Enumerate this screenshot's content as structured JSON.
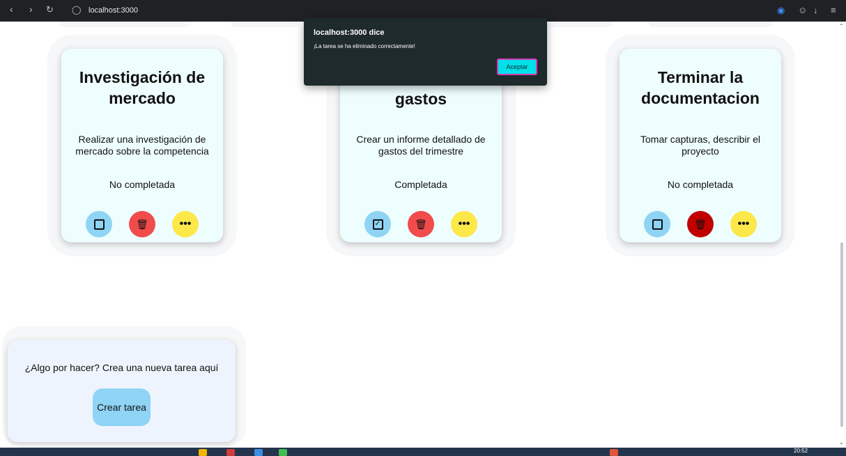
{
  "browser": {
    "url": "localhost:3000",
    "back_icon": "chevron-left-icon",
    "forward_icon": "chevron-right-icon",
    "reload_icon": "reload-icon",
    "site_icon": "globe-icon"
  },
  "cards": [
    {
      "title": "Investigación de mercado",
      "description": "Realizar una investigación de mercado sobre la competencia",
      "status": "No completada",
      "completed": false
    },
    {
      "title": "gastos",
      "description": "Crear un informe detallado de gastos del trimestre",
      "status": "Completada",
      "completed": true
    },
    {
      "title": "Terminar la documentacion",
      "description": "Tomar capturas, describir el proyecto",
      "status": "No completada",
      "completed": false
    }
  ],
  "create_panel": {
    "prompt": "¿Algo por hacer? Crea una nueva tarea aquí",
    "button_label": "Crear tarea"
  },
  "dialog": {
    "title": "localhost:3000 dice",
    "message": "¡La tarea se ha eliminado correctamente!",
    "ok_label": "Aceptar"
  },
  "taskbar": {
    "clock": "20:52"
  },
  "colors": {
    "card_bg": "#eefdfd",
    "check_button": "#8fd4f5",
    "delete_button": "#f14b4b",
    "more_button": "#fde84a",
    "dialog_bg": "#1f2a2d",
    "ok_button": "#00e0e8"
  }
}
